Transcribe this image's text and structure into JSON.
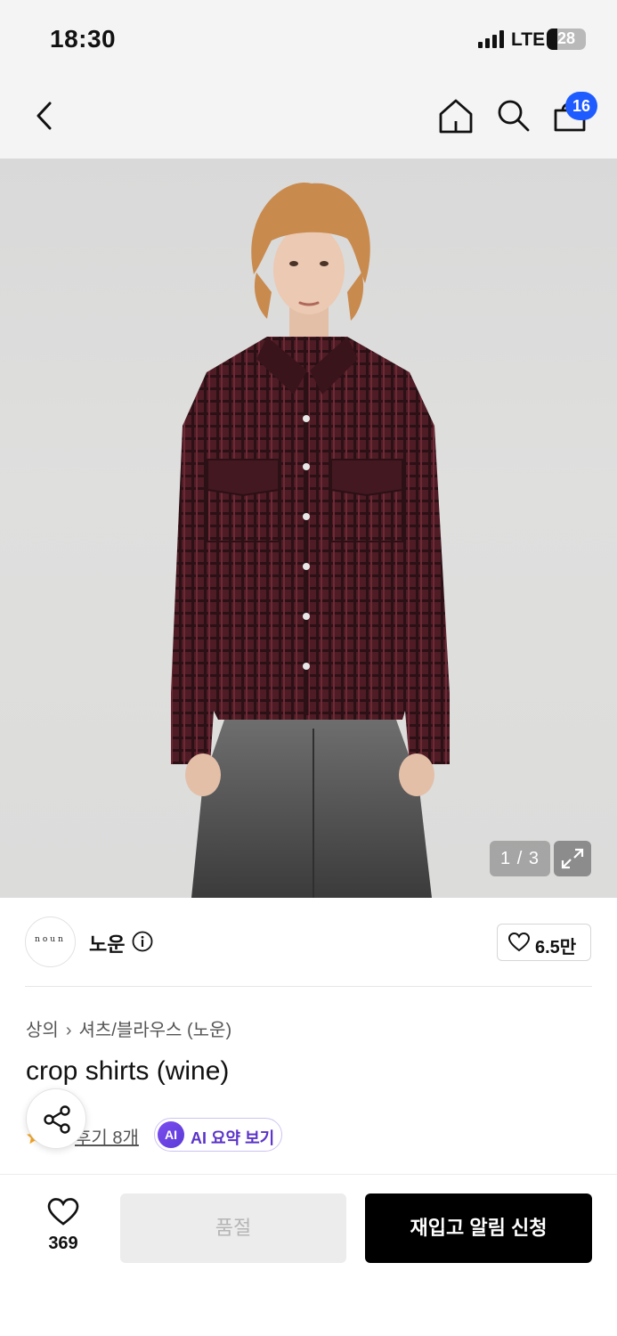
{
  "status_bar": {
    "time": "18:30",
    "network": "LTE",
    "battery": "28",
    "battery_level": 0.28
  },
  "header": {
    "cart_count": "16"
  },
  "gallery": {
    "pager": "1 / 3"
  },
  "brand": {
    "logo_text": "noun",
    "name": "노운",
    "likes": "6.5만"
  },
  "product": {
    "breadcrumb": [
      "상의",
      "셔츠/블라우스 (노운)"
    ],
    "title": "crop shirts (wine)",
    "reviews": "후기 8개",
    "ai_badge": "AI",
    "ai_summary_label": "AI 요약 보기"
  },
  "bottom_bar": {
    "wish_count": "369",
    "soldout_label": "품절",
    "restock_label": "재입고 알림 신청"
  },
  "colors": {
    "accent_blue": "#1f5cff",
    "ai_purple": "#5a33c9",
    "shirt_wine": "#4f1c25"
  },
  "icons": [
    "back-icon",
    "home-icon",
    "search-icon",
    "cart-icon",
    "expand-icon",
    "info-icon",
    "heart-icon",
    "share-icon",
    "star-icon"
  ]
}
